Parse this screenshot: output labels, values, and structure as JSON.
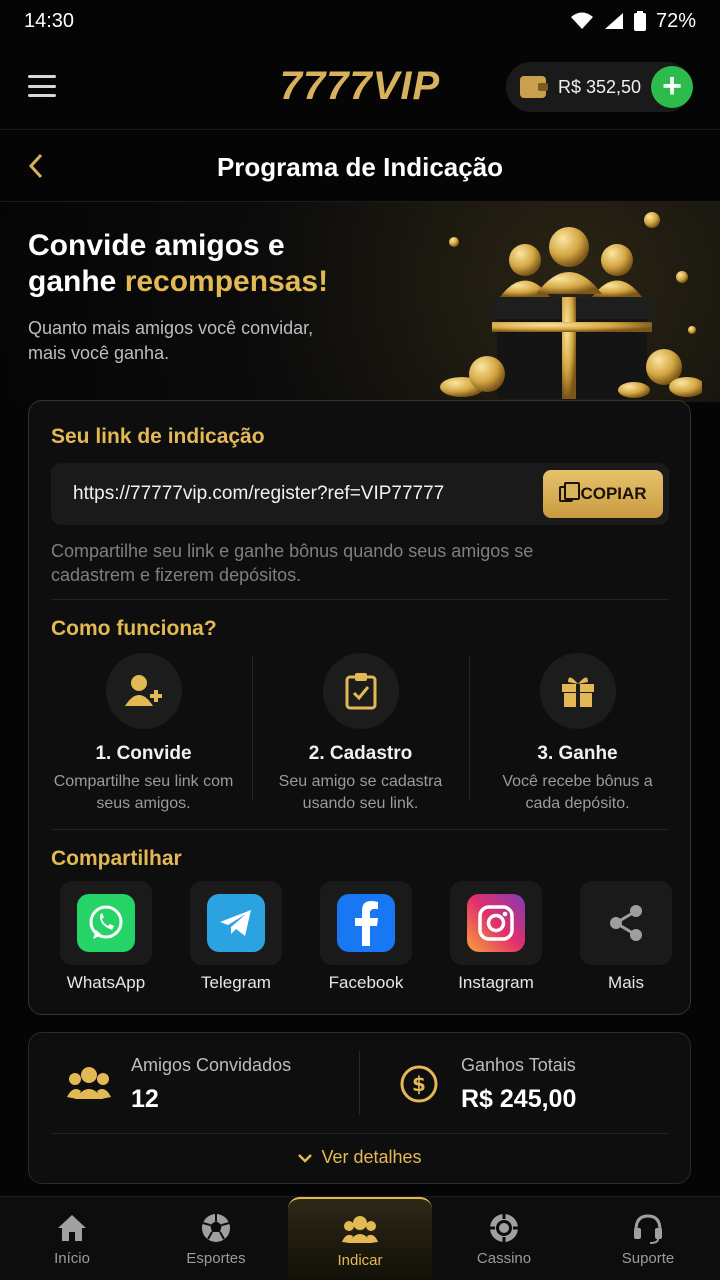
{
  "status": {
    "time": "14:30",
    "battery": "72%"
  },
  "header": {
    "logo": "7777VIP",
    "balance": "R$ 352,50",
    "add_label": "+"
  },
  "page": {
    "title": "Programa de Indicação"
  },
  "hero": {
    "title_part1": "Convide amigos e",
    "title_part2": "ganhe ",
    "title_highlight": "recompensas!",
    "subtitle": "Quanto mais amigos você convidar, mais você ganha."
  },
  "referral": {
    "section_title": "Seu link de indicação",
    "link": "https://77777vip.com/register?ref=VIP77777",
    "copy_label": "COPIAR",
    "help": "Compartilhe seu link e ganhe bônus quando seus amigos se cadastrem e fizerem depósitos."
  },
  "how": {
    "title": "Como funciona?",
    "steps": [
      {
        "title": "1. Convide",
        "desc": "Compartilhe seu link com seus amigos.",
        "icon": "add-user-icon"
      },
      {
        "title": "2. Cadastro",
        "desc": "Seu amigo se cadastra usando seu link.",
        "icon": "clipboard-check-icon"
      },
      {
        "title": "3. Ganhe",
        "desc": "Você recebe bônus a cada depósito.",
        "icon": "gift-icon"
      }
    ]
  },
  "share": {
    "title": "Compartilhar",
    "items": [
      {
        "label": "WhatsApp",
        "icon": "whatsapp-icon",
        "color": "#25D366"
      },
      {
        "label": "Telegram",
        "icon": "telegram-icon",
        "color": "#2AA3E0"
      },
      {
        "label": "Facebook",
        "icon": "facebook-icon",
        "color": "#1877F2"
      },
      {
        "label": "Instagram",
        "icon": "instagram-icon",
        "color": "#E1306C"
      },
      {
        "label": "Mais",
        "icon": "share-icon",
        "color": "#9E9E9E"
      }
    ]
  },
  "stats": {
    "friends_label": "Amigos Convidados",
    "friends_value": "12",
    "earnings_label": "Ganhos Totais",
    "earnings_value": "R$ 245,00",
    "details_label": "Ver detalhes"
  },
  "nav": {
    "items": [
      {
        "label": "Início",
        "icon": "home-icon"
      },
      {
        "label": "Esportes",
        "icon": "soccer-ball-icon"
      },
      {
        "label": "Indicar",
        "icon": "users-icon"
      },
      {
        "label": "Cassino",
        "icon": "casino-chip-icon"
      },
      {
        "label": "Suporte",
        "icon": "headset-icon"
      }
    ],
    "active_index": 2
  },
  "colors": {
    "accent": "#E2B955",
    "background": "#050505",
    "card": "#0E0E0E"
  }
}
